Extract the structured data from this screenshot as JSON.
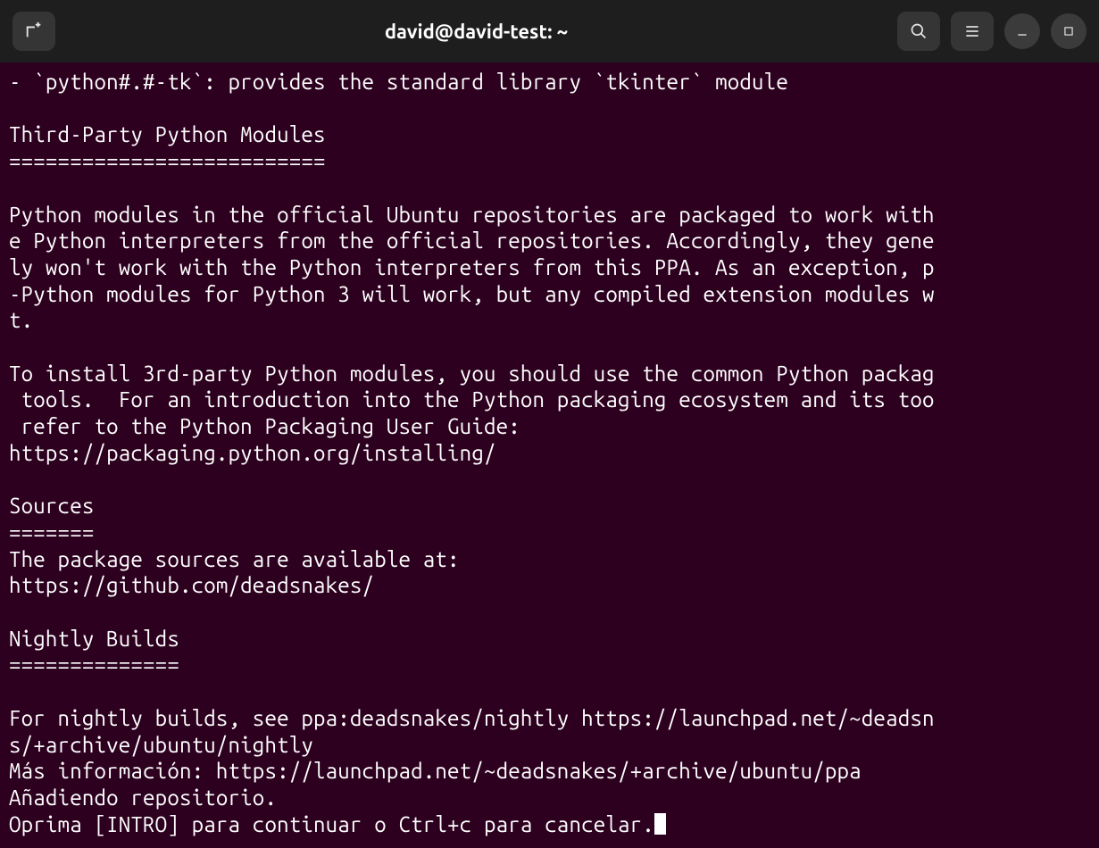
{
  "titlebar": {
    "title": "david@david-test: ~"
  },
  "terminal": {
    "lines": [
      "- `python#.#-tk`: provides the standard library `tkinter` module",
      "",
      "Third-Party Python Modules",
      "==========================",
      "",
      "Python modules in the official Ubuntu repositories are packaged to work with",
      "e Python interpreters from the official repositories. Accordingly, they gene",
      "ly won't work with the Python interpreters from this PPA. As an exception, p",
      "-Python modules for Python 3 will work, but any compiled extension modules w",
      "t.",
      "",
      "To install 3rd-party Python modules, you should use the common Python packag",
      " tools.  For an introduction into the Python packaging ecosystem and its too",
      " refer to the Python Packaging User Guide:",
      "https://packaging.python.org/installing/",
      "",
      "Sources",
      "=======",
      "The package sources are available at:",
      "https://github.com/deadsnakes/",
      "",
      "Nightly Builds",
      "==============",
      "",
      "For nightly builds, see ppa:deadsnakes/nightly https://launchpad.net/~deadsn",
      "s/+archive/ubuntu/nightly",
      "Más información: https://launchpad.net/~deadsnakes/+archive/ubuntu/ppa",
      "Añadiendo repositorio."
    ],
    "prompt_line": "Oprima [INTRO] para continuar o Ctrl+c para cancelar."
  }
}
